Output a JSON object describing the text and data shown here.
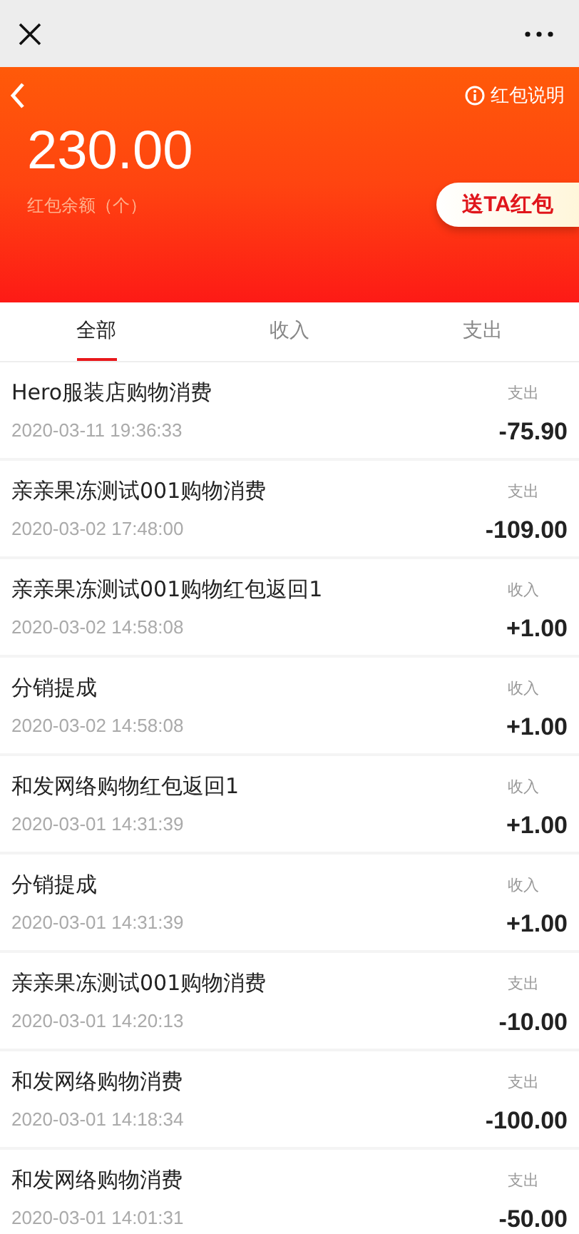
{
  "header": {
    "balance": "230.00",
    "balance_label": "红包余额（个）",
    "help_link": "红包说明",
    "send_button": "送TA红包"
  },
  "tabs": [
    {
      "label": "全部",
      "selected": true
    },
    {
      "label": "收入",
      "selected": false
    },
    {
      "label": "支出",
      "selected": false
    }
  ],
  "records": [
    {
      "title": "Hero服装店购物消费",
      "time": "2020-03-11 19:36:33",
      "type": "支出",
      "amount": "-75.90"
    },
    {
      "title": "亲亲果冻测试001购物消费",
      "time": "2020-03-02 17:48:00",
      "type": "支出",
      "amount": "-109.00"
    },
    {
      "title": "亲亲果冻测试001购物红包返回1",
      "time": "2020-03-02 14:58:08",
      "type": "收入",
      "amount": "+1.00"
    },
    {
      "title": "分销提成",
      "time": "2020-03-02 14:58:08",
      "type": "收入",
      "amount": "+1.00"
    },
    {
      "title": "和发网络购物红包返回1",
      "time": "2020-03-01 14:31:39",
      "type": "收入",
      "amount": "+1.00"
    },
    {
      "title": "分销提成",
      "time": "2020-03-01 14:31:39",
      "type": "收入",
      "amount": "+1.00"
    },
    {
      "title": "亲亲果冻测试001购物消费",
      "time": "2020-03-01 14:20:13",
      "type": "支出",
      "amount": "-10.00"
    },
    {
      "title": "和发网络购物消费",
      "time": "2020-03-01 14:18:34",
      "type": "支出",
      "amount": "-100.00"
    },
    {
      "title": "和发网络购物消费",
      "time": "2020-03-01 14:01:31",
      "type": "支出",
      "amount": "-50.00"
    }
  ]
}
